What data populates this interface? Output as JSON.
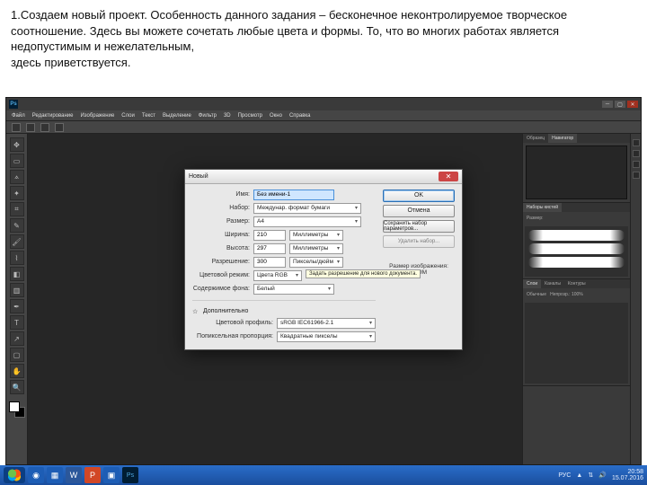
{
  "caption": "1.Создаем новый проект. Особенность данного задания – бесконечное  неконтролируемое творческое  соотношение. Здесь вы можете сочетать любые цвета и формы. То, что во многих работах является недопустимым и нежелательным,\nздесь приветствуется.",
  "ps": {
    "logo": "Ps",
    "menus": [
      "Файл",
      "Редактирование",
      "Изображение",
      "Слои",
      "Текст",
      "Выделение",
      "Фильтр",
      "3D",
      "Просмотр",
      "Окно",
      "Справка"
    ]
  },
  "panels": {
    "nav": {
      "tabs": [
        "Образец",
        "Навигатор"
      ],
      "active": 1
    },
    "brush": {
      "tabs": [
        "Наборы кистей"
      ],
      "label": "Размер:"
    },
    "layers": {
      "tabs": [
        "Слои",
        "Каналы",
        "Контуры"
      ],
      "mode": "Обычные",
      "opacity": "Непрозр.: 100%"
    }
  },
  "dialog": {
    "title": "Новый",
    "name_label": "Имя:",
    "name_value": "Без имени-1",
    "preset_label": "Набор:",
    "preset_value": "Междунар. формат бумаги",
    "size_label": "Размер:",
    "size_value": "A4",
    "width_label": "Ширина:",
    "width_value": "210",
    "height_label": "Высота:",
    "height_value": "297",
    "unit_mm": "Миллиметры",
    "res_label": "Разрешение:",
    "res_value": "300",
    "res_unit": "Пикселы/дюйм",
    "mode_label": "Цветовой режим:",
    "mode_value": "Цвета RGB",
    "bg_label": "Содержимое фона:",
    "bg_value": "Белый",
    "adv_label": "Дополнительно",
    "profile_label": "Цветовой профиль:",
    "profile_value": "sRGB IEC61966-2.1",
    "aspect_label": "Попиксельная пропорция:",
    "aspect_value": "Квадратные пикселы",
    "tooltip": "Задать разрешение для нового документа.",
    "btn_ok": "OK",
    "btn_cancel": "Отмена",
    "btn_save": "Сохранить набор параметров...",
    "btn_del": "Удалить набор...",
    "filesize_label": "Размер изображения:",
    "filesize_value": "24,9M"
  },
  "taskbar": {
    "lang": "РУС",
    "time": "20:58",
    "date": "15.07.2016"
  }
}
